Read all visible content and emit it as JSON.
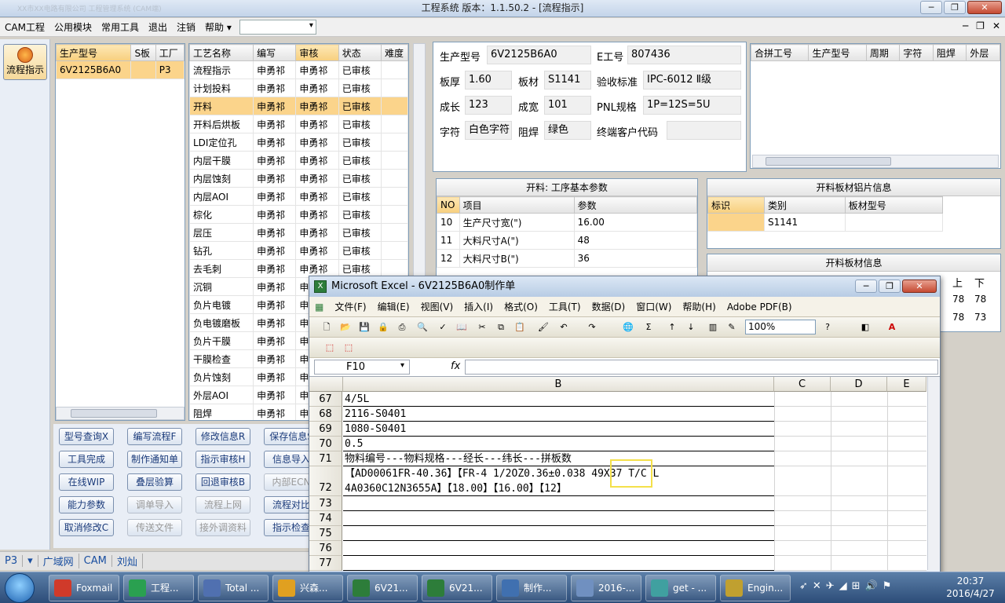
{
  "titlebar": {
    "blurred": "XX市XX电路有限公司 工程管理系统 (CAM端)",
    "title": "工程系统   版本：1.1.50.2 - [流程指示]"
  },
  "menu": [
    "CAM工程",
    "公用模块",
    "常用工具",
    "退出",
    "注销",
    "帮助"
  ],
  "help_arrow": "▾",
  "left_tab": {
    "label": "流程指示"
  },
  "prod_list": {
    "headers": [
      "生产型号",
      "S板",
      "工厂"
    ],
    "rows": [
      [
        "6V2125B6A0",
        "",
        "P3"
      ]
    ]
  },
  "process": {
    "headers": [
      "工艺名称",
      "编写",
      "审核",
      "状态",
      "难度"
    ],
    "rows": [
      [
        "流程指示",
        "申勇祁",
        "申勇祁",
        "已审核"
      ],
      [
        "计划投料",
        "申勇祁",
        "申勇祁",
        "已审核"
      ],
      [
        "开料",
        "申勇祁",
        "申勇祁",
        "已审核"
      ],
      [
        "开料后烘板",
        "申勇祁",
        "申勇祁",
        "已审核"
      ],
      [
        "LDI定位孔",
        "申勇祁",
        "申勇祁",
        "已审核"
      ],
      [
        "内层干膜",
        "申勇祁",
        "申勇祁",
        "已审核"
      ],
      [
        "内层蚀刻",
        "申勇祁",
        "申勇祁",
        "已审核"
      ],
      [
        "内层AOI",
        "申勇祁",
        "申勇祁",
        "已审核"
      ],
      [
        "棕化",
        "申勇祁",
        "申勇祁",
        "已审核"
      ],
      [
        "层压",
        "申勇祁",
        "申勇祁",
        "已审核"
      ],
      [
        "钻孔",
        "申勇祁",
        "申勇祁",
        "已审核"
      ],
      [
        "去毛刺",
        "申勇祁",
        "申勇祁",
        "已审核"
      ],
      [
        "沉铜",
        "申勇祁",
        "申"
      ],
      [
        "负片电镀",
        "申勇祁",
        "申"
      ],
      [
        "负电镀磨板",
        "申勇祁",
        "申"
      ],
      [
        "负片干膜",
        "申勇祁",
        "申"
      ],
      [
        "干膜检查",
        "申勇祁",
        "申"
      ],
      [
        "负片蚀刻",
        "申勇祁",
        "申"
      ],
      [
        "外层AOI",
        "申勇祁",
        "申"
      ],
      [
        "阻焊",
        "申勇祁",
        "申"
      ]
    ]
  },
  "buttons": [
    [
      "型号查询X",
      "编写流程F",
      "修改信息R",
      "保存信息S"
    ],
    [
      "工具完成",
      "制作通知单",
      "指示审核H",
      "信息导入"
    ],
    [
      "在线WIP",
      "叠层验算",
      "回退审核B",
      "内部ECN"
    ],
    [
      "能力参数",
      "调单导入",
      "流程上网",
      "流程对比"
    ],
    [
      "取消修改C",
      "传送文件",
      "接外调资料",
      "指示检查"
    ]
  ],
  "info": {
    "prod_model_lbl": "生产型号",
    "prod_model": "6V2125B6A0",
    "e_no_lbl": "E工号",
    "e_no": "807436",
    "thick_lbl": "板厚",
    "thick": "1.60",
    "mat_lbl": "板材",
    "mat": "S1141",
    "std_lbl": "验收标准",
    "std": "IPC-6012 Ⅱ级",
    "len_lbl": "成长",
    "len": "123",
    "wid_lbl": "成宽",
    "wid": "101",
    "pnl_lbl": "PNL规格",
    "pnl": "1P=12S=5U",
    "char_lbl": "字符",
    "char": "白色字符",
    "mask_lbl": "阻焊",
    "mask": "绿色",
    "cust_lbl": "终端客户代码",
    "cust": ""
  },
  "merge": {
    "headers": [
      "合拼工号",
      "生产型号",
      "周期",
      "字符",
      "阻焊",
      "外层"
    ]
  },
  "params": {
    "title": "开料: 工序基本参数",
    "headers": [
      "NO",
      "项目",
      "参数"
    ],
    "rows": [
      [
        "10",
        "生产尺寸宽(\")",
        "16.00"
      ],
      [
        "11",
        "大料尺寸A(\")",
        "48"
      ],
      [
        "12",
        "大料尺寸B(\")",
        "36"
      ]
    ]
  },
  "alu": {
    "title": "开料板材铝片信息",
    "headers": [
      "标识",
      "类别",
      "板材型号"
    ],
    "rows": [
      [
        "",
        "S1141",
        ""
      ]
    ]
  },
  "sheet_info": {
    "title": "开料板材信息",
    "col_h": [
      "上",
      "下"
    ],
    "vals": [
      [
        "78",
        "78"
      ],
      [
        "78",
        "73"
      ]
    ]
  },
  "status": [
    "P3",
    "广域网",
    "CAM",
    "刘灿"
  ],
  "excel": {
    "title": "Microsoft Excel - 6V2125B6A0制作单",
    "menu": [
      "文件(F)",
      "编辑(E)",
      "视图(V)",
      "插入(I)",
      "格式(O)",
      "工具(T)",
      "数据(D)",
      "窗口(W)",
      "帮助(H)",
      "Adobe PDF(B)"
    ],
    "zoom": "100%",
    "namebox": "F10",
    "fx": "fx",
    "cols": [
      "B",
      "C",
      "D",
      "E"
    ],
    "rows": [
      {
        "n": "67",
        "v": "4/5L"
      },
      {
        "n": "68",
        "v": "2116-S0401"
      },
      {
        "n": "69",
        "v": "1080-S0401"
      },
      {
        "n": "70",
        "v": "0.5"
      },
      {
        "n": "71",
        "v": "物料编号---物料规格---经长---纬长---拼板数"
      },
      {
        "n": "72",
        "v": "【AD00061FR-40.36】【FR-4 1/2OZ0.36±0.038 49X37  T/C L",
        "v2": "4A0360C12N3655A】【18.00】【16.00】【12】"
      },
      {
        "n": "73",
        "v": ""
      },
      {
        "n": "74",
        "v": ""
      },
      {
        "n": "75",
        "v": ""
      },
      {
        "n": "76",
        "v": ""
      },
      {
        "n": "77",
        "v": ""
      }
    ]
  },
  "taskbar": [
    {
      "t": "Foxmail",
      "c": "#d03a2a"
    },
    {
      "t": "工程...",
      "c": "#2aa050"
    },
    {
      "t": "Total ...",
      "c": "#5070b0"
    },
    {
      "t": "兴森...",
      "c": "#e0a020"
    },
    {
      "t": "6V21...",
      "c": "#2d7d3a"
    },
    {
      "t": "6V21...",
      "c": "#2d7d3a"
    },
    {
      "t": "制作...",
      "c": "#4070b0"
    },
    {
      "t": "2016-...",
      "c": "#7090c0"
    },
    {
      "t": "get - ...",
      "c": "#40a0a0"
    },
    {
      "t": "Engin...",
      "c": "#c0a030"
    }
  ],
  "clock": {
    "time": "20:37",
    "date": "2016/4/27"
  }
}
